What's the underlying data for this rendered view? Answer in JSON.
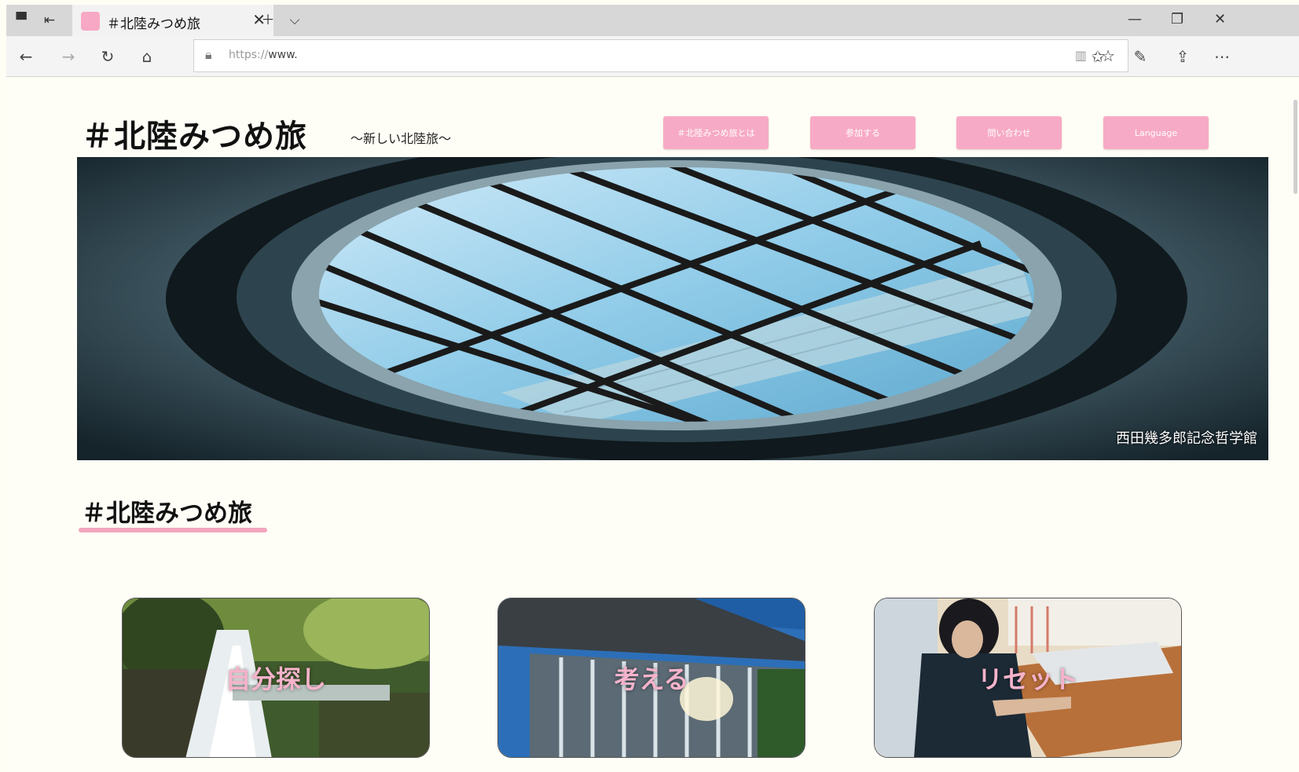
{
  "browser": {
    "tab_title": "＃北陸みつめ旅",
    "url_prefix": "https://",
    "url_host": "www.",
    "accent": "#f7a8c4"
  },
  "site": {
    "title": "＃北陸みつめ旅",
    "subtitle": "～新しい北陸旅～",
    "nav": [
      {
        "label": "＃北陸みつめ旅とは"
      },
      {
        "label": "参加する"
      },
      {
        "label": "問い合わせ"
      },
      {
        "label": "Language"
      }
    ],
    "hero_caption": "西田幾多郎記念哲学館",
    "section_title": "＃北陸みつめ旅",
    "cards": [
      {
        "label": "自分探し"
      },
      {
        "label": "考える"
      },
      {
        "label": "リセット"
      }
    ],
    "button_color": "#f7aac5",
    "underline_color": "#f3a6bf"
  }
}
